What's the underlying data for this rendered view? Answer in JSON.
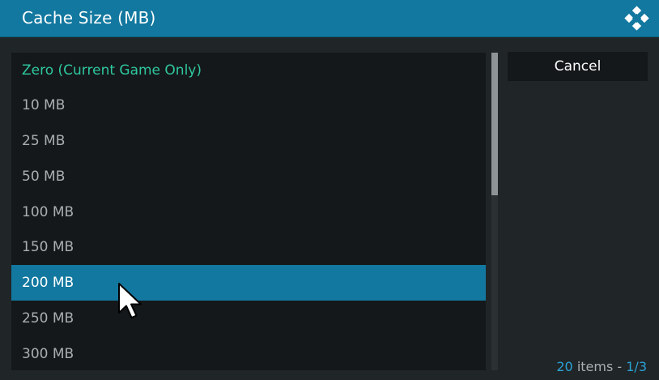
{
  "dialog": {
    "title": "Cache Size (MB)",
    "logo_icon": "kodi-logo-icon"
  },
  "list": {
    "items": [
      {
        "label": "Zero (Current Game Only)",
        "state": "current"
      },
      {
        "label": "10 MB",
        "state": "normal"
      },
      {
        "label": "25 MB",
        "state": "normal"
      },
      {
        "label": "50 MB",
        "state": "normal"
      },
      {
        "label": "100 MB",
        "state": "normal"
      },
      {
        "label": "150 MB",
        "state": "normal"
      },
      {
        "label": "200 MB",
        "state": "focused"
      },
      {
        "label": "250 MB",
        "state": "normal"
      },
      {
        "label": "300 MB",
        "state": "normal"
      }
    ]
  },
  "buttons": {
    "cancel_label": "Cancel"
  },
  "footer": {
    "count": "20",
    "items_text": " items - ",
    "page": "1/3"
  },
  "colors": {
    "header": "#12789f",
    "current_item": "#2ec8a0",
    "accent": "#2aa2d4"
  }
}
